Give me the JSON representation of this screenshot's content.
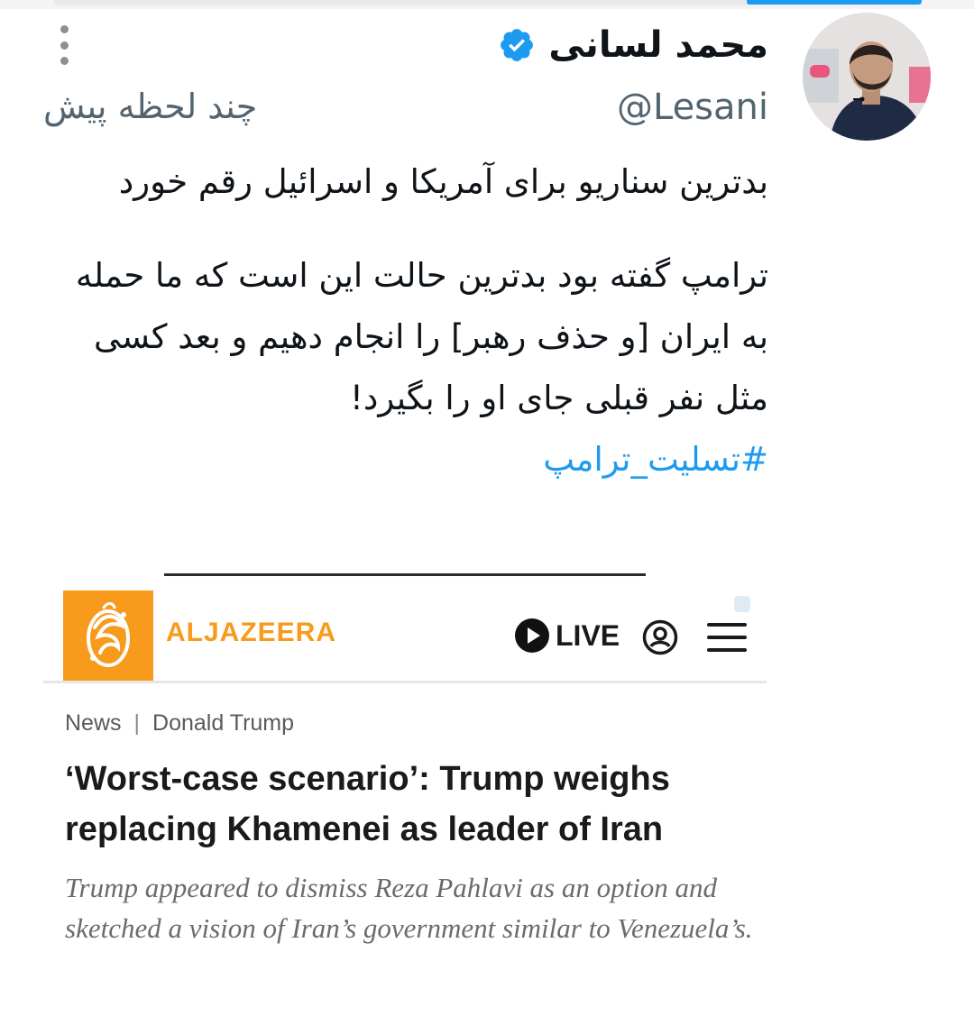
{
  "tweet": {
    "author_name": "محمد لسانی",
    "handle": "@Lesani",
    "timestamp": "چند لحظه پیش",
    "lines": [
      "بدترین سناریو برای آمریکا و اسرائیل رقم خورد",
      "ترامپ گفته بود بدترین حالت این است که ما حمله به ایران [و حذف رهبر] را انجام دهیم و بعد کسی  مثل نفر قبلی جای او را بگیرد!"
    ],
    "hashtag": "#تسلیت_ترامپ",
    "colors": {
      "text": "#0f1419",
      "secondary": "#536471",
      "link": "#1d9bf0",
      "verified": "#1d9bf0"
    },
    "icons": [
      "more-vertical-icon",
      "verified-badge-icon",
      "avatar"
    ]
  },
  "embed": {
    "brand": "ALJAZEERA",
    "live_label": "LIVE",
    "breadcrumb": {
      "section": "News",
      "separator": "|",
      "topic": "Donald Trump"
    },
    "headline": "‘Worst-case scenario’: Trump weighs replacing Khamenei as leader of Iran",
    "summary": "Trump appeared to dismiss Reza Pahlavi as an option and sketched a vision of Iran’s government similar to Venezuela’s.",
    "colors": {
      "brand": "#f89a1c",
      "headline": "#1a1a1a",
      "summary": "#6b6b6b"
    },
    "icons": [
      "aljazeera-logo-icon",
      "play-icon",
      "user-icon",
      "menu-icon"
    ]
  }
}
